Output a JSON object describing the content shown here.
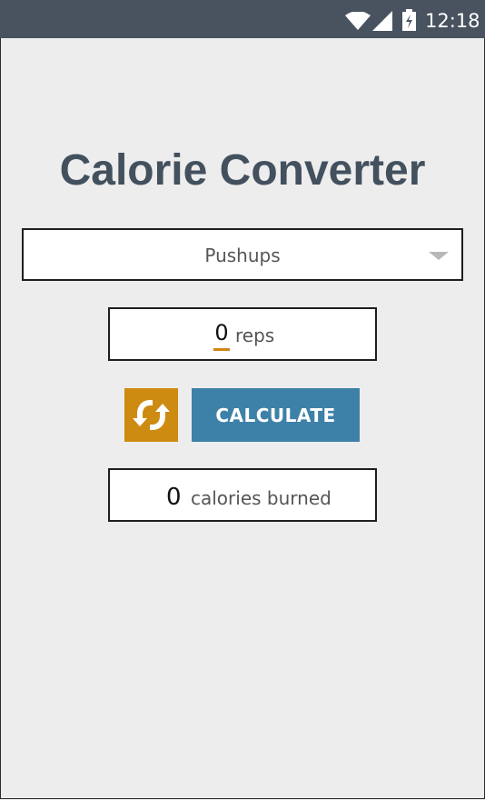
{
  "status_bar": {
    "time": "12:18",
    "icons": [
      "wifi-icon",
      "signal-icon",
      "battery-charging-icon"
    ]
  },
  "title": "Calorie Converter",
  "exercise_select": {
    "selected": "Pushups",
    "icon": "dropdown-arrow-icon"
  },
  "reps_input": {
    "value": "0",
    "unit_label": "reps"
  },
  "buttons": {
    "reset_icon": "refresh-icon",
    "calculate_label": "CALCULATE"
  },
  "result": {
    "value": "0",
    "label": "calories burned"
  },
  "colors": {
    "status_bar": "#48535f",
    "background": "#ededed",
    "title": "#43505e",
    "accent_orange": "#ce8b12",
    "button_blue": "#3e81a8",
    "border": "#1e1e1e"
  }
}
